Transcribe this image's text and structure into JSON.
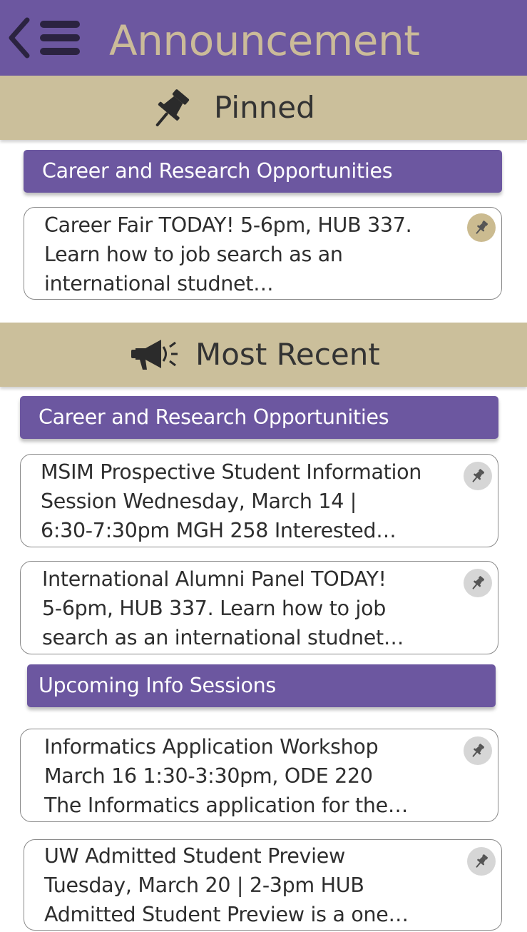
{
  "header": {
    "title": "Announcement",
    "back_icon": "chevron-left-icon",
    "menu_icon": "hamburger-menu-icon"
  },
  "colors": {
    "header_purple": "#6c57a0",
    "title_tan": "#cbbb99",
    "section_tan": "#cbbf9b",
    "pinned_badge": "#cbbb90",
    "unpinned_badge": "#d6d6d6"
  },
  "pinned": {
    "label": "Pinned",
    "icon": "pushpin-icon",
    "category": "Career and Research Opportunities",
    "items": [
      {
        "lines": [
          "Career Fair TODAY! 5-6pm, HUB 337.",
          "Learn how to job search as an",
          "international studnet…"
        ],
        "pinned": true
      }
    ]
  },
  "recent": {
    "label": "Most Recent",
    "icon": "megaphone-icon",
    "groups": [
      {
        "category": "Career and Research Opportunities",
        "items": [
          {
            "lines": [
              "MSIM Prospective Student Information",
              "Session Wednesday, March 14 |",
              "6:30-7:30pm MGH 258 Interested…"
            ],
            "pinned": false
          },
          {
            "lines": [
              "International Alumni Panel TODAY!",
              "5-6pm, HUB 337. Learn how to job",
              "search as an international studnet…"
            ],
            "pinned": false
          }
        ]
      },
      {
        "category": "Upcoming Info Sessions",
        "items": [
          {
            "lines": [
              "Informatics Application Workshop",
              "March 16 1:30-3:30pm, ODE 220",
              "The Informatics application for the…"
            ],
            "pinned": false
          },
          {
            "lines": [
              "UW Admitted Student Preview",
              "Tuesday, March 20 | 2-3pm HUB",
              "Admitted Student Preview is a one…"
            ],
            "pinned": false
          }
        ]
      }
    ]
  }
}
